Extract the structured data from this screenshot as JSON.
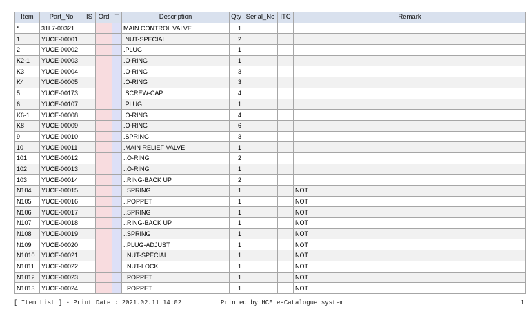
{
  "columns": [
    "Item",
    "Part_No",
    "IS",
    "Ord",
    "T",
    "Description",
    "Qty",
    "Serial_No",
    "ITC",
    "Remark"
  ],
  "rows": [
    {
      "item": "*",
      "part_no": "31L7-00321",
      "is": "",
      "ord": "",
      "t": "",
      "description": "MAIN CONTROL VALVE",
      "qty": "1",
      "serial_no": "",
      "itc": "",
      "remark": ""
    },
    {
      "item": "1",
      "part_no": "YUCE-00001",
      "is": "",
      "ord": "",
      "t": "",
      "description": ".NUT-SPECIAL",
      "qty": "2",
      "serial_no": "",
      "itc": "",
      "remark": ""
    },
    {
      "item": "2",
      "part_no": "YUCE-00002",
      "is": "",
      "ord": "",
      "t": "",
      "description": ".PLUG",
      "qty": "1",
      "serial_no": "",
      "itc": "",
      "remark": ""
    },
    {
      "item": "K2-1",
      "part_no": "YUCE-00003",
      "is": "",
      "ord": "",
      "t": "",
      "description": ".O-RING",
      "qty": "1",
      "serial_no": "",
      "itc": "",
      "remark": ""
    },
    {
      "item": "K3",
      "part_no": "YUCE-00004",
      "is": "",
      "ord": "",
      "t": "",
      "description": ".O-RING",
      "qty": "3",
      "serial_no": "",
      "itc": "",
      "remark": ""
    },
    {
      "item": "K4",
      "part_no": "YUCE-00005",
      "is": "",
      "ord": "",
      "t": "",
      "description": ".O-RING",
      "qty": "3",
      "serial_no": "",
      "itc": "",
      "remark": ""
    },
    {
      "item": "5",
      "part_no": "YUCE-00173",
      "is": "",
      "ord": "",
      "t": "",
      "description": ".SCREW-CAP",
      "qty": "4",
      "serial_no": "",
      "itc": "",
      "remark": ""
    },
    {
      "item": "6",
      "part_no": "YUCE-00107",
      "is": "",
      "ord": "",
      "t": "",
      "description": ".PLUG",
      "qty": "1",
      "serial_no": "",
      "itc": "",
      "remark": ""
    },
    {
      "item": "K6-1",
      "part_no": "YUCE-00008",
      "is": "",
      "ord": "",
      "t": "",
      "description": ".O-RING",
      "qty": "4",
      "serial_no": "",
      "itc": "",
      "remark": ""
    },
    {
      "item": "K8",
      "part_no": "YUCE-00009",
      "is": "",
      "ord": "",
      "t": "",
      "description": ".O-RING",
      "qty": "6",
      "serial_no": "",
      "itc": "",
      "remark": ""
    },
    {
      "item": "9",
      "part_no": "YUCE-00010",
      "is": "",
      "ord": "",
      "t": "",
      "description": ".SPRING",
      "qty": "3",
      "serial_no": "",
      "itc": "",
      "remark": ""
    },
    {
      "item": "10",
      "part_no": "YUCE-00011",
      "is": "",
      "ord": "",
      "t": "",
      "description": ".MAIN RELIEF VALVE",
      "qty": "1",
      "serial_no": "",
      "itc": "",
      "remark": ""
    },
    {
      "item": "101",
      "part_no": "YUCE-00012",
      "is": "",
      "ord": "",
      "t": "",
      "description": "..O-RING",
      "qty": "2",
      "serial_no": "",
      "itc": "",
      "remark": ""
    },
    {
      "item": "102",
      "part_no": "YUCE-00013",
      "is": "",
      "ord": "",
      "t": "",
      "description": "..O-RING",
      "qty": "1",
      "serial_no": "",
      "itc": "",
      "remark": ""
    },
    {
      "item": "103",
      "part_no": "YUCE-00014",
      "is": "",
      "ord": "",
      "t": "",
      "description": "..RING-BACK UP",
      "qty": "2",
      "serial_no": "",
      "itc": "",
      "remark": ""
    },
    {
      "item": "N104",
      "part_no": "YUCE-00015",
      "is": "",
      "ord": "",
      "t": "",
      "description": "..SPRING",
      "qty": "1",
      "serial_no": "",
      "itc": "",
      "remark": "NOT"
    },
    {
      "item": "N105",
      "part_no": "YUCE-00016",
      "is": "",
      "ord": "",
      "t": "",
      "description": "..POPPET",
      "qty": "1",
      "serial_no": "",
      "itc": "",
      "remark": "NOT"
    },
    {
      "item": "N106",
      "part_no": "YUCE-00017",
      "is": "",
      "ord": "",
      "t": "",
      "description": "..SPRING",
      "qty": "1",
      "serial_no": "",
      "itc": "",
      "remark": "NOT"
    },
    {
      "item": "N107",
      "part_no": "YUCE-00018",
      "is": "",
      "ord": "",
      "t": "",
      "description": "..RING-BACK UP",
      "qty": "1",
      "serial_no": "",
      "itc": "",
      "remark": "NOT"
    },
    {
      "item": "N108",
      "part_no": "YUCE-00019",
      "is": "",
      "ord": "",
      "t": "",
      "description": "..SPRING",
      "qty": "1",
      "serial_no": "",
      "itc": "",
      "remark": "NOT"
    },
    {
      "item": "N109",
      "part_no": "YUCE-00020",
      "is": "",
      "ord": "",
      "t": "",
      "description": "..PLUG-ADJUST",
      "qty": "1",
      "serial_no": "",
      "itc": "",
      "remark": "NOT"
    },
    {
      "item": "N1010",
      "part_no": "YUCE-00021",
      "is": "",
      "ord": "",
      "t": "",
      "description": "..NUT-SPECIAL",
      "qty": "1",
      "serial_no": "",
      "itc": "",
      "remark": "NOT"
    },
    {
      "item": "N1011",
      "part_no": "YUCE-00022",
      "is": "",
      "ord": "",
      "t": "",
      "description": "..NUT-LOCK",
      "qty": "1",
      "serial_no": "",
      "itc": "",
      "remark": "NOT"
    },
    {
      "item": "N1012",
      "part_no": "YUCE-00023",
      "is": "",
      "ord": "",
      "t": "",
      "description": "..POPPET",
      "qty": "1",
      "serial_no": "",
      "itc": "",
      "remark": "NOT"
    },
    {
      "item": "N1013",
      "part_no": "YUCE-00024",
      "is": "",
      "ord": "",
      "t": "",
      "description": "..POPPET",
      "qty": "1",
      "serial_no": "",
      "itc": "",
      "remark": "NOT"
    }
  ],
  "footer": {
    "left": "[ Item List ] - Print Date : 2021.02.11 14:02",
    "middle": "Printed by HCE e-Catalogue system",
    "page": "1"
  },
  "colors": {
    "header_bg": "#d9e1ee",
    "ord_col": "#f8dcdf",
    "t_col": "#dde0f7",
    "stripe": "#f1f1f1"
  }
}
